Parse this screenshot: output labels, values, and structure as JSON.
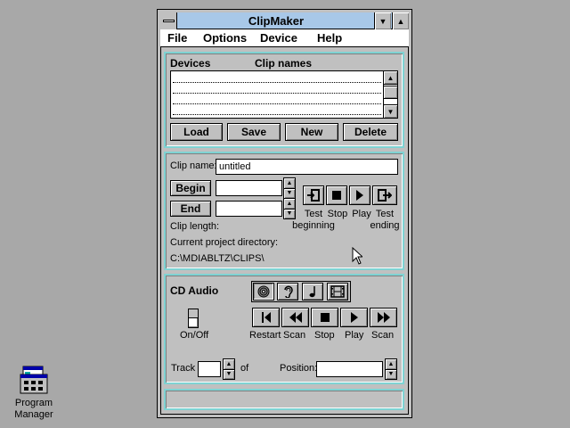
{
  "window": {
    "title": "ClipMaker"
  },
  "menu": [
    "File",
    "Options",
    "Device",
    "Help"
  ],
  "list": {
    "col_devices": "Devices",
    "col_clipnames": "Clip names"
  },
  "list_buttons": {
    "load": "Load",
    "save": "Save",
    "new": "New",
    "delete": "Delete"
  },
  "clip": {
    "name_label": "Clip name:",
    "name_value": "untitled",
    "begin": "Begin",
    "end": "End",
    "length_label": "Clip length:",
    "dir_label": "Current project directory:",
    "dir_value": "C:\\MDIABLTZ\\CLIPS\\",
    "test_beginning_1": "Test",
    "test_beginning_2": "beginning",
    "stop": "Stop",
    "play": "Play",
    "test_ending_1": "Test",
    "test_ending_2": "ending"
  },
  "cd": {
    "title": "CD Audio",
    "onoff": "On/Off",
    "restart": "Restart",
    "scan_back": "Scan",
    "stop": "Stop",
    "play": "Play",
    "scan_fwd": "Scan",
    "track": "Track",
    "of": "of",
    "position": "Position:"
  },
  "desktop": {
    "icon_label_1": "Program",
    "icon_label_2": "Manager"
  },
  "icons": [
    "system-menu-icon",
    "minimize-icon",
    "maximize-icon",
    "scroll-up-icon",
    "scroll-down-icon",
    "test-beginning-icon",
    "stop-icon",
    "play-icon",
    "test-ending-icon",
    "cd-disc-icon",
    "ear-icon",
    "music-note-icon",
    "film-icon",
    "restart-icon",
    "rewind-icon",
    "fast-forward-icon",
    "toggle-switch-icon",
    "mouse-cursor-icon",
    "program-manager-icon"
  ],
  "colors": {
    "desktop": "#a8a8a8",
    "titlebar": "#a8c8e8",
    "panel": "#c0c0c0",
    "border_accent": "#7fd3d3"
  }
}
